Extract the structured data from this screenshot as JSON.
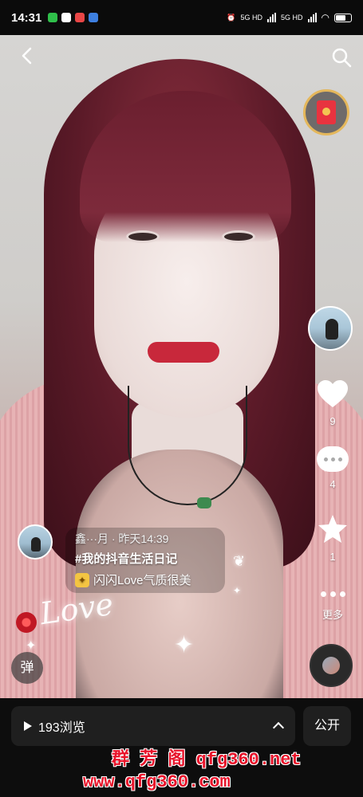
{
  "status_bar": {
    "time": "14:31",
    "network_label_1": "5G HD",
    "network_label_2": "5G HD"
  },
  "top_nav": {
    "back_icon": "chevron-left-icon",
    "search_icon": "search-icon"
  },
  "side_actions": {
    "red_packet_icon": "red-envelope-icon",
    "like_count": "9",
    "comment_count": "4",
    "favorite_count": "1",
    "more_label": "更多"
  },
  "post": {
    "author_and_time": "鑫···月 · 昨天14:39",
    "hashtag": "#我的抖音生活日记",
    "caption_text": "闪闪Love气质很美"
  },
  "overlay": {
    "love_sticker": "Love",
    "danmaku_label": "弹"
  },
  "bottom_bar": {
    "views_label": "193浏览",
    "public_label": "公开"
  },
  "watermark": {
    "line1": "群 芳 阁 qfg360.net",
    "line2": "www.qfg360.com"
  },
  "colors": {
    "like": "#ffffff",
    "watermark_red": "#e8132a",
    "red_packet": "#e8333f",
    "gold_ring": "#e4b75b"
  }
}
